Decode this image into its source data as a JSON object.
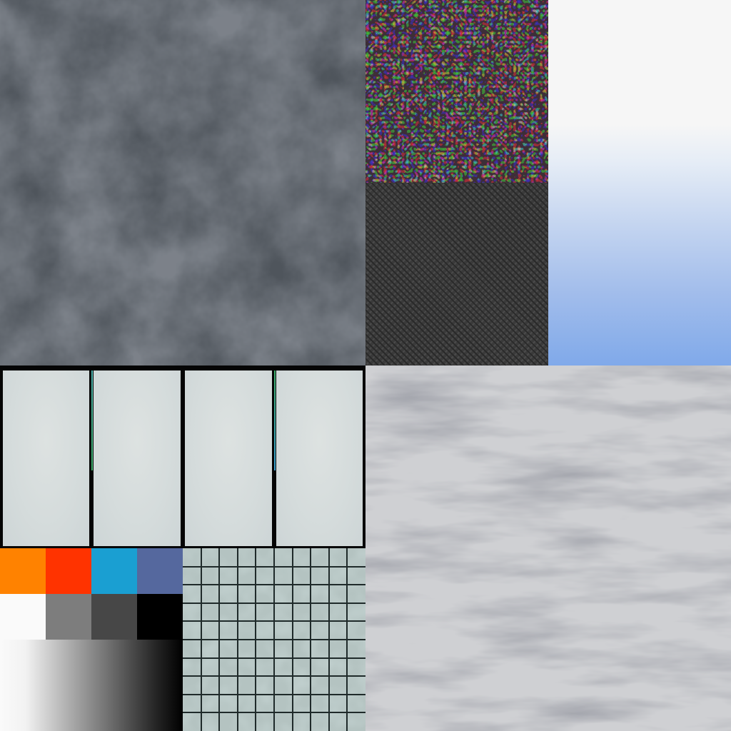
{
  "atlas": {
    "tiles": [
      {
        "name": "dark-cloudy-stone",
        "base_color": "#474c53"
      },
      {
        "name": "mottled-speckle",
        "base_color": "#3b3133"
      },
      {
        "name": "diagonal-weave",
        "base_color": "#3a3a3a"
      },
      {
        "name": "sky-gradient",
        "colors": [
          "#f6f6f6",
          "#80a9ea"
        ]
      },
      {
        "name": "pale-panels",
        "panel_count": 4,
        "panel_color": "#d4dbdb"
      },
      {
        "name": "grey-marble",
        "base_color": "#c6c7cb"
      },
      {
        "name": "grayscale-ramp",
        "colors": [
          "#fafafa",
          "#000000"
        ]
      },
      {
        "name": "teal-grid",
        "base_color": "#aebebc",
        "line_color": "#1f2a2a"
      }
    ],
    "swatches": [
      {
        "name": "orange",
        "color": "#ff8200"
      },
      {
        "name": "red",
        "color": "#ff3300"
      },
      {
        "name": "cyan",
        "color": "#1a9fd2"
      },
      {
        "name": "slate-blue",
        "color": "#55689e"
      },
      {
        "name": "white",
        "color": "#fafafa"
      },
      {
        "name": "mid-grey",
        "color": "#7d7d7d"
      },
      {
        "name": "dark-grey",
        "color": "#474747"
      },
      {
        "name": "black",
        "color": "#000000"
      }
    ],
    "panel_edge_colors": [
      "#4fb3b0",
      "#3fae6a",
      "#3a9fd0"
    ]
  }
}
